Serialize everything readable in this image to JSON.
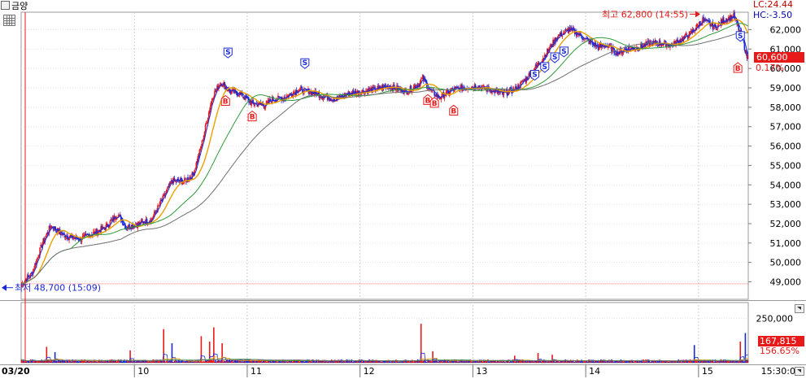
{
  "header": {
    "title": "금양"
  },
  "indicators": {
    "lc": "LC:24.44",
    "hc": "HC:-3.50"
  },
  "price_axis": {
    "ticks": [
      "62,000",
      "61,000",
      "60,000",
      "59,000",
      "58,000",
      "57,000",
      "56,000",
      "55,000",
      "54,000",
      "53,000",
      "52,000",
      "51,000",
      "50,000",
      "49,000"
    ]
  },
  "current": {
    "price": "60,600",
    "change": "0.17%"
  },
  "annotations": {
    "high": "최고 62,800 (14:55)",
    "low": "최저 48,700 (15:09)"
  },
  "volume_axis": {
    "tick": "250,000",
    "current": "167,815",
    "ratio": "156.65%"
  },
  "time_axis": {
    "labels": [
      "03/20",
      "10",
      "11",
      "12",
      "13",
      "14",
      "15",
      "15:30:00"
    ]
  },
  "signals": {
    "sell": "S",
    "buy": "B"
  },
  "colors": {
    "up": "#e81919",
    "down": "#1a2bd6",
    "ma5": "#1a2bd6",
    "ma20": "#e8a000",
    "ma60": "#2e9a3a",
    "ma120": "#707070",
    "high_marker": "#e81919",
    "low_marker": "#1a2bd6"
  },
  "chart_data": {
    "type": "candlestick",
    "ylim": [
      48100,
      62900
    ],
    "anchors": [
      [
        0,
        48900
      ],
      [
        12,
        49400
      ],
      [
        25,
        51000
      ],
      [
        35,
        51900
      ],
      [
        50,
        51400
      ],
      [
        70,
        51200
      ],
      [
        85,
        51500
      ],
      [
        100,
        51800
      ],
      [
        115,
        52500
      ],
      [
        125,
        51800
      ],
      [
        140,
        52000
      ],
      [
        155,
        52200
      ],
      [
        168,
        53200
      ],
      [
        180,
        54200
      ],
      [
        195,
        54200
      ],
      [
        205,
        54500
      ],
      [
        215,
        56000
      ],
      [
        228,
        58500
      ],
      [
        238,
        59300
      ],
      [
        250,
        58800
      ],
      [
        262,
        58700
      ],
      [
        275,
        58200
      ],
      [
        290,
        58100
      ],
      [
        300,
        58400
      ],
      [
        315,
        58500
      ],
      [
        330,
        58900
      ],
      [
        345,
        58800
      ],
      [
        360,
        58600
      ],
      [
        375,
        58400
      ],
      [
        390,
        58700
      ],
      [
        405,
        58800
      ],
      [
        420,
        58900
      ],
      [
        440,
        59100
      ],
      [
        460,
        58800
      ],
      [
        475,
        59200
      ],
      [
        480,
        59500
      ],
      [
        488,
        58900
      ],
      [
        500,
        58500
      ],
      [
        515,
        58900
      ],
      [
        530,
        59000
      ],
      [
        545,
        59100
      ],
      [
        560,
        58900
      ],
      [
        575,
        58700
      ],
      [
        590,
        58900
      ],
      [
        600,
        59300
      ],
      [
        612,
        59900
      ],
      [
        625,
        60600
      ],
      [
        640,
        61600
      ],
      [
        655,
        62000
      ],
      [
        665,
        61800
      ],
      [
        678,
        61400
      ],
      [
        690,
        61100
      ],
      [
        700,
        61200
      ],
      [
        712,
        60800
      ],
      [
        725,
        61000
      ],
      [
        740,
        61100
      ],
      [
        752,
        61300
      ],
      [
        765,
        61300
      ],
      [
        778,
        61200
      ],
      [
        790,
        61500
      ],
      [
        800,
        61800
      ],
      [
        815,
        62500
      ],
      [
        830,
        62100
      ],
      [
        840,
        62500
      ],
      [
        852,
        62700
      ],
      [
        862,
        61600
      ],
      [
        868,
        60600
      ]
    ],
    "vol_spikes": [
      [
        30,
        90000
      ],
      [
        40,
        60000
      ],
      [
        130,
        70000
      ],
      [
        170,
        190000
      ],
      [
        180,
        110000
      ],
      [
        215,
        150000
      ],
      [
        225,
        120000
      ],
      [
        230,
        200000
      ],
      [
        240,
        110000
      ],
      [
        478,
        220000
      ],
      [
        492,
        65000
      ],
      [
        590,
        40000
      ],
      [
        618,
        55000
      ],
      [
        635,
        45000
      ],
      [
        805,
        100000
      ],
      [
        860,
        120000
      ],
      [
        866,
        167815
      ]
    ],
    "ma": [
      {
        "name": "ma5",
        "period": 5
      },
      {
        "name": "ma20",
        "period": 20
      },
      {
        "name": "ma60",
        "period": 60
      },
      {
        "name": "ma120",
        "period": 120
      }
    ],
    "high": {
      "price": 62800,
      "index": 815
    },
    "low": {
      "price": 48700,
      "index": 3
    },
    "sell_signals": [
      [
        247,
        60800
      ],
      [
        339,
        60250
      ],
      [
        614,
        59650
      ],
      [
        626,
        60050
      ],
      [
        638,
        60550
      ],
      [
        649,
        60850
      ],
      [
        860,
        61650
      ]
    ],
    "buy_signals": [
      [
        244,
        58350
      ],
      [
        276,
        57550
      ],
      [
        486,
        58400
      ],
      [
        494,
        58250
      ],
      [
        517,
        57850
      ],
      [
        857,
        60050
      ]
    ],
    "day_separators": [
      [
        135,
        "10"
      ],
      [
        270,
        "11"
      ],
      [
        405,
        "12"
      ],
      [
        540,
        "13"
      ],
      [
        675,
        "14"
      ],
      [
        810,
        "15"
      ]
    ]
  }
}
